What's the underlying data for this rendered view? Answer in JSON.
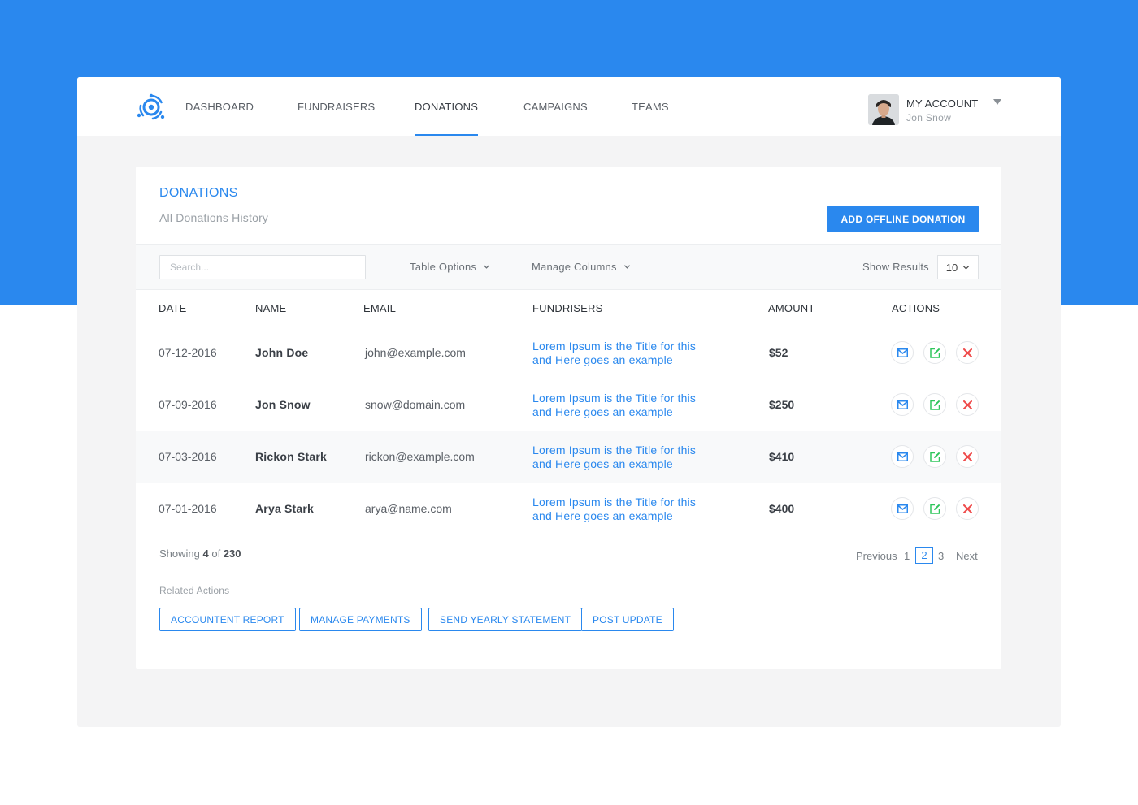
{
  "nav": {
    "items": [
      {
        "label": "DASHBOARD"
      },
      {
        "label": "FUNDRAISERS"
      },
      {
        "label": "DONATIONS"
      },
      {
        "label": "CAMPAIGNS"
      },
      {
        "label": "TEAMS"
      }
    ],
    "active": "DONATIONS",
    "account_title": "MY ACCOUNT",
    "account_name": "Jon Snow"
  },
  "page": {
    "title": "DONATIONS",
    "subtitle": "All Donations History",
    "add_button": "ADD OFFLINE DONATION"
  },
  "toolbar": {
    "search_placeholder": "Search...",
    "table_options": "Table Options",
    "manage_columns": "Manage Columns",
    "show_results_label": "Show Results",
    "show_results_value": "10"
  },
  "table": {
    "headers": [
      "DATE",
      "NAME",
      "EMAIL",
      "FUNDRISERS",
      "AMOUNT",
      "ACTIONS"
    ],
    "rows": [
      {
        "date": "07-12-2016",
        "name": "John Doe",
        "email": "john@example.com",
        "fund_line1": "Lorem Ipsum is the Title for this",
        "fund_line2": "and Here goes an example",
        "amount": "$52"
      },
      {
        "date": "07-09-2016",
        "name": "Jon Snow",
        "email": "snow@domain.com",
        "fund_line1": "Lorem Ipsum is the Title for this",
        "fund_line2": "and Here goes an example",
        "amount": "$250"
      },
      {
        "date": "07-03-2016",
        "name": "Rickon Stark",
        "email": "rickon@example.com",
        "fund_line1": "Lorem Ipsum is the Title for this",
        "fund_line2": "and Here goes an example",
        "amount": "$410"
      },
      {
        "date": "07-01-2016",
        "name": "Arya Stark",
        "email": "arya@name.com",
        "fund_line1": "Lorem Ipsum is the Title for this",
        "fund_line2": "and Here goes an example",
        "amount": "$400"
      }
    ],
    "action_icons": [
      "mail-icon",
      "edit-icon",
      "delete-icon"
    ]
  },
  "footer": {
    "showing_prefix": "Showing",
    "showing_count": "4",
    "showing_of": "of",
    "showing_total": "230",
    "pagination": {
      "previous": "Previous",
      "pages": [
        "1",
        "2",
        "3"
      ],
      "current": "2",
      "next": "Next"
    },
    "related_label": "Related Actions",
    "related_buttons": [
      "ACCOUNTENT REPORT",
      "MANAGE PAYMENTS",
      "SEND YEARLY STATEMENT",
      "POST UPDATE"
    ]
  },
  "colors": {
    "accent": "#2a88ee",
    "edit": "#2ec55b",
    "delete": "#ef4b4b"
  }
}
